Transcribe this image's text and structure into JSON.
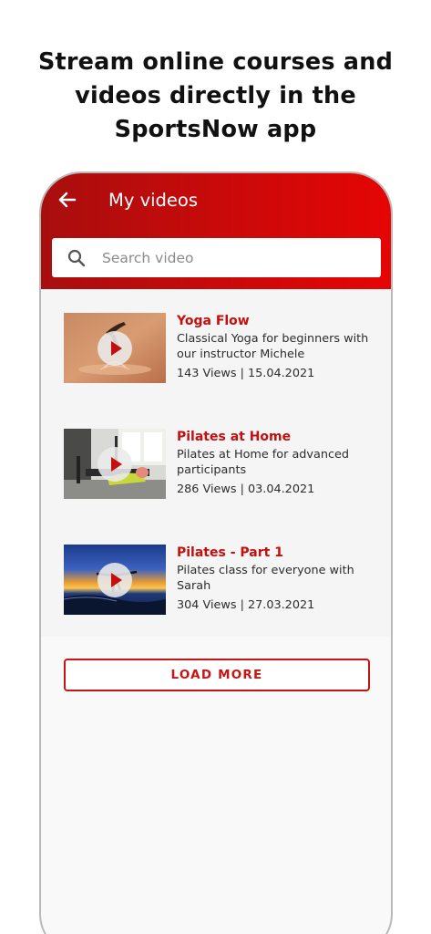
{
  "promo": {
    "line1": "Stream online courses and",
    "line2": "videos directly in the",
    "line3": "SportsNow app"
  },
  "header": {
    "title": "My videos",
    "back_icon": "arrow-left-icon"
  },
  "search": {
    "placeholder": "Search video",
    "icon": "search-icon"
  },
  "videos": [
    {
      "title": "Yoga Flow",
      "description": "Classical Yoga for beginners with our instructor Michele",
      "meta": "143 Views | 15.04.2021",
      "thumbnail": "yoga-splash-thumbnail"
    },
    {
      "title": "Pilates at Home",
      "description": "Pilates at Home for advanced participants",
      "meta": "286 Views | 03.04.2021",
      "thumbnail": "pilates-reformer-thumbnail"
    },
    {
      "title": "Pilates - Part 1",
      "description": "Pilates class for everyone with Sarah",
      "meta": "304 Views | 27.03.2021",
      "thumbnail": "beach-sunset-yoga-thumbnail"
    }
  ],
  "load_more_label": "LOAD MORE",
  "colors": {
    "brand_red": "#c30f0f",
    "header_gradient_start": "#a80e0e",
    "header_gradient_end": "#e50505"
  }
}
